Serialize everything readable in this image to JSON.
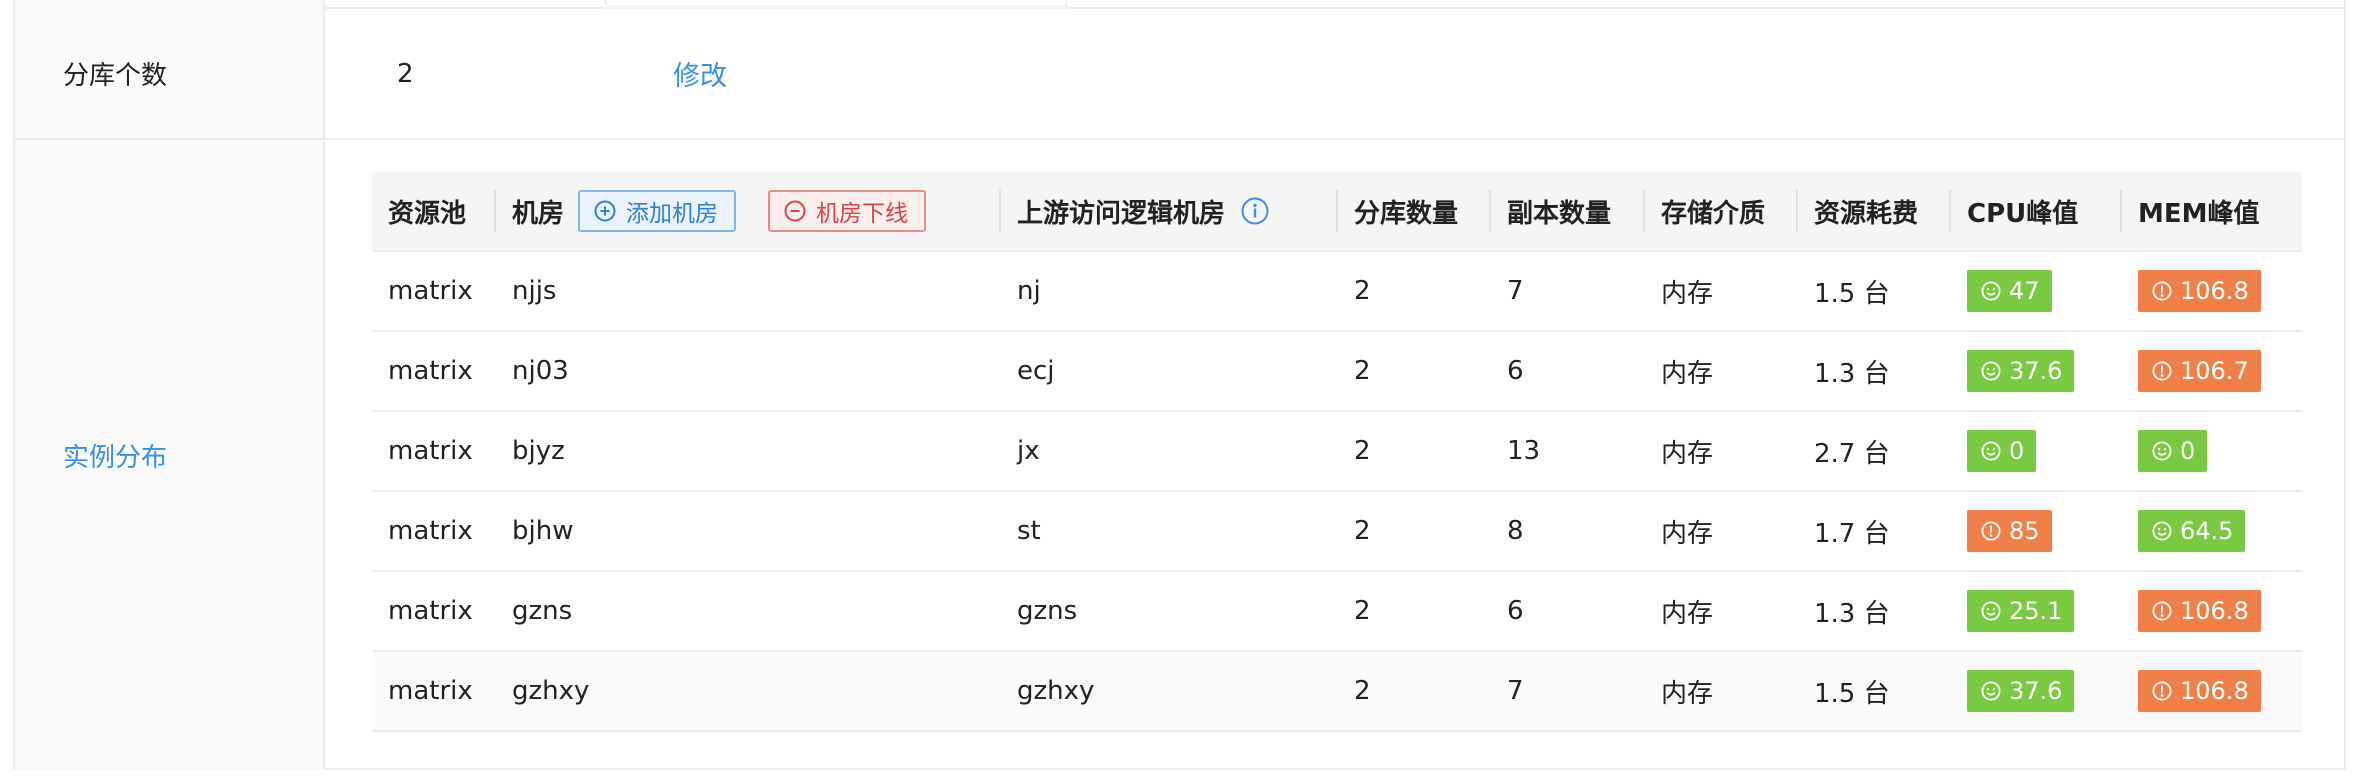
{
  "shards": {
    "label": "分库个数",
    "value": "2",
    "modify": "修改"
  },
  "distribution": {
    "label": "实例分布"
  },
  "table": {
    "headers": {
      "pool": "资源池",
      "room": "机房",
      "add_room": "添加机房",
      "offline_room": "机房下线",
      "upstream": "上游访问逻辑机房",
      "shard_count": "分库数量",
      "replica_count": "副本数量",
      "storage": "存储介质",
      "cost": "资源耗费",
      "cpu": "CPU峰值",
      "mem": "MEM峰值"
    },
    "rows": [
      {
        "pool": "matrix",
        "room": "njjs",
        "upstream": "nj",
        "shards": "2",
        "replicas": "7",
        "storage": "内存",
        "cost": "1.5 台",
        "cpu": "47",
        "cpu_status": "ok",
        "mem": "106.8",
        "mem_status": "warn"
      },
      {
        "pool": "matrix",
        "room": "nj03",
        "upstream": "ecj",
        "shards": "2",
        "replicas": "6",
        "storage": "内存",
        "cost": "1.3 台",
        "cpu": "37.6",
        "cpu_status": "ok",
        "mem": "106.7",
        "mem_status": "warn"
      },
      {
        "pool": "matrix",
        "room": "bjyz",
        "upstream": "jx",
        "shards": "2",
        "replicas": "13",
        "storage": "内存",
        "cost": "2.7 台",
        "cpu": "0",
        "cpu_status": "ok",
        "mem": "0",
        "mem_status": "ok"
      },
      {
        "pool": "matrix",
        "room": "bjhw",
        "upstream": "st",
        "shards": "2",
        "replicas": "8",
        "storage": "内存",
        "cost": "1.7 台",
        "cpu": "85",
        "cpu_status": "warn",
        "mem": "64.5",
        "mem_status": "ok"
      },
      {
        "pool": "matrix",
        "room": "gzns",
        "upstream": "gzns",
        "shards": "2",
        "replicas": "6",
        "storage": "内存",
        "cost": "1.3 台",
        "cpu": "25.1",
        "cpu_status": "ok",
        "mem": "106.8",
        "mem_status": "warn"
      },
      {
        "pool": "matrix",
        "room": "gzhxy",
        "upstream": "gzhxy",
        "shards": "2",
        "replicas": "7",
        "storage": "内存",
        "cost": "1.5 台",
        "cpu": "37.6",
        "cpu_status": "ok",
        "mem": "106.8",
        "mem_status": "warn"
      }
    ]
  },
  "icons": {
    "add": "plus-circle-icon",
    "offline": "minus-circle-icon",
    "info": "info-circle-icon",
    "ok": "smile-icon",
    "warn": "exclamation-circle-icon"
  },
  "colors": {
    "link": "#3a8ee6",
    "ok": "#7ac943",
    "warn": "#f07f4a",
    "add_border": "#7fb6ee",
    "offline_border": "#e98b8b"
  }
}
